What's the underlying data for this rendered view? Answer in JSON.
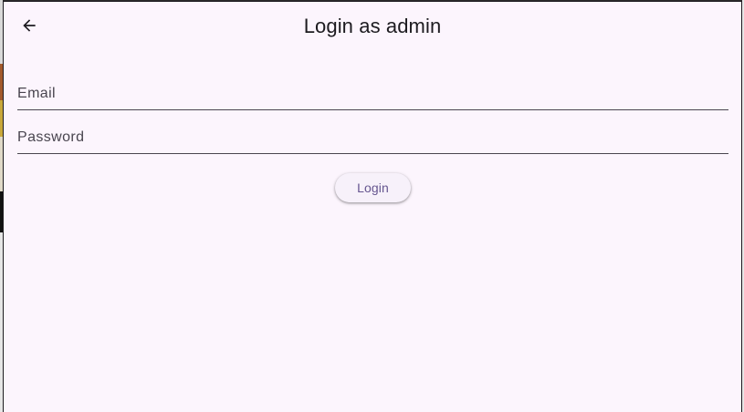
{
  "appbar": {
    "title": "Login as admin",
    "back_icon": "arrow-back-icon"
  },
  "form": {
    "email_placeholder": "Email",
    "email_value": "",
    "password_placeholder": "Password",
    "password_value": "",
    "login_label": "Login"
  },
  "colors": {
    "background": "#fcf5fd",
    "text": "#1d1b20",
    "accent": "#65558f",
    "underline": "#49454f"
  }
}
